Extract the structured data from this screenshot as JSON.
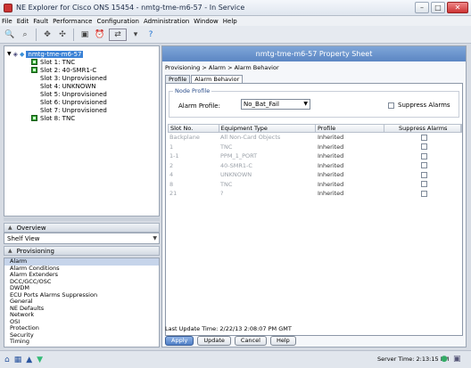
{
  "window": {
    "title": "NE Explorer for Cisco ONS 15454 - nmtg-tme-m6-57 - In Service"
  },
  "menu": [
    "File",
    "Edit",
    "Fault",
    "Performance",
    "Configuration",
    "Administration",
    "Window",
    "Help"
  ],
  "tree": {
    "root": "nmtg-tme-m6-57",
    "slots": [
      "Slot 1: TNC",
      "Slot 2: 40-SMR1-C",
      "Slot 3: Unprovisioned",
      "Slot 4: UNKNOWN",
      "Slot 5: Unprovisioned",
      "Slot 6: Unprovisioned",
      "Slot 7: Unprovisioned",
      "Slot 8: TNC"
    ]
  },
  "overview": {
    "label": "Overview",
    "shelf_view": "Shelf View"
  },
  "provisioning": {
    "label": "Provisioning",
    "items": [
      "Alarm",
      "Alarm Conditions",
      "Alarm Extenders",
      "DCC/GCC/OSC",
      "DWDM",
      "ECU Ports Alarms Suppression",
      "General",
      "NE Defaults",
      "Network",
      "OSI",
      "Protection",
      "Security",
      "Timing"
    ]
  },
  "property_sheet": {
    "title": "nmtg-tme-m6-57 Property Sheet",
    "breadcrumb": "Provisioning > Alarm > Alarm Behavior",
    "tabs": [
      "Profile",
      "Alarm Behavior"
    ],
    "node_profile": "Node Profile",
    "alarm_profile_label": "Alarm Profile:",
    "alarm_profile_value": "No_Bat_Fail",
    "suppress_label": "Suppress Alarms",
    "columns": [
      "Slot No.",
      "Equipment Type",
      "Profile",
      "Suppress Alarms"
    ],
    "rows": [
      {
        "slot": "Backplane",
        "type": "All Non-Card Objects",
        "profile": "Inherited"
      },
      {
        "slot": "1",
        "type": "TNC",
        "profile": "Inherited"
      },
      {
        "slot": "1-1",
        "type": "PPM_1_PORT",
        "profile": "Inherited"
      },
      {
        "slot": "2",
        "type": "40-SMR1-C",
        "profile": "Inherited"
      },
      {
        "slot": "4",
        "type": "UNKNOWN",
        "profile": "Inherited"
      },
      {
        "slot": "8",
        "type": "TNC",
        "profile": "Inherited"
      },
      {
        "slot": "21",
        "type": "?",
        "profile": "Inherited"
      }
    ],
    "last_update": "Last Update Time: 2/22/13 2:08:07 PM GMT",
    "buttons": [
      "Apply",
      "Update",
      "Cancel",
      "Help"
    ]
  },
  "status": {
    "server_time": "Server Time: 2:13:15 PM"
  }
}
